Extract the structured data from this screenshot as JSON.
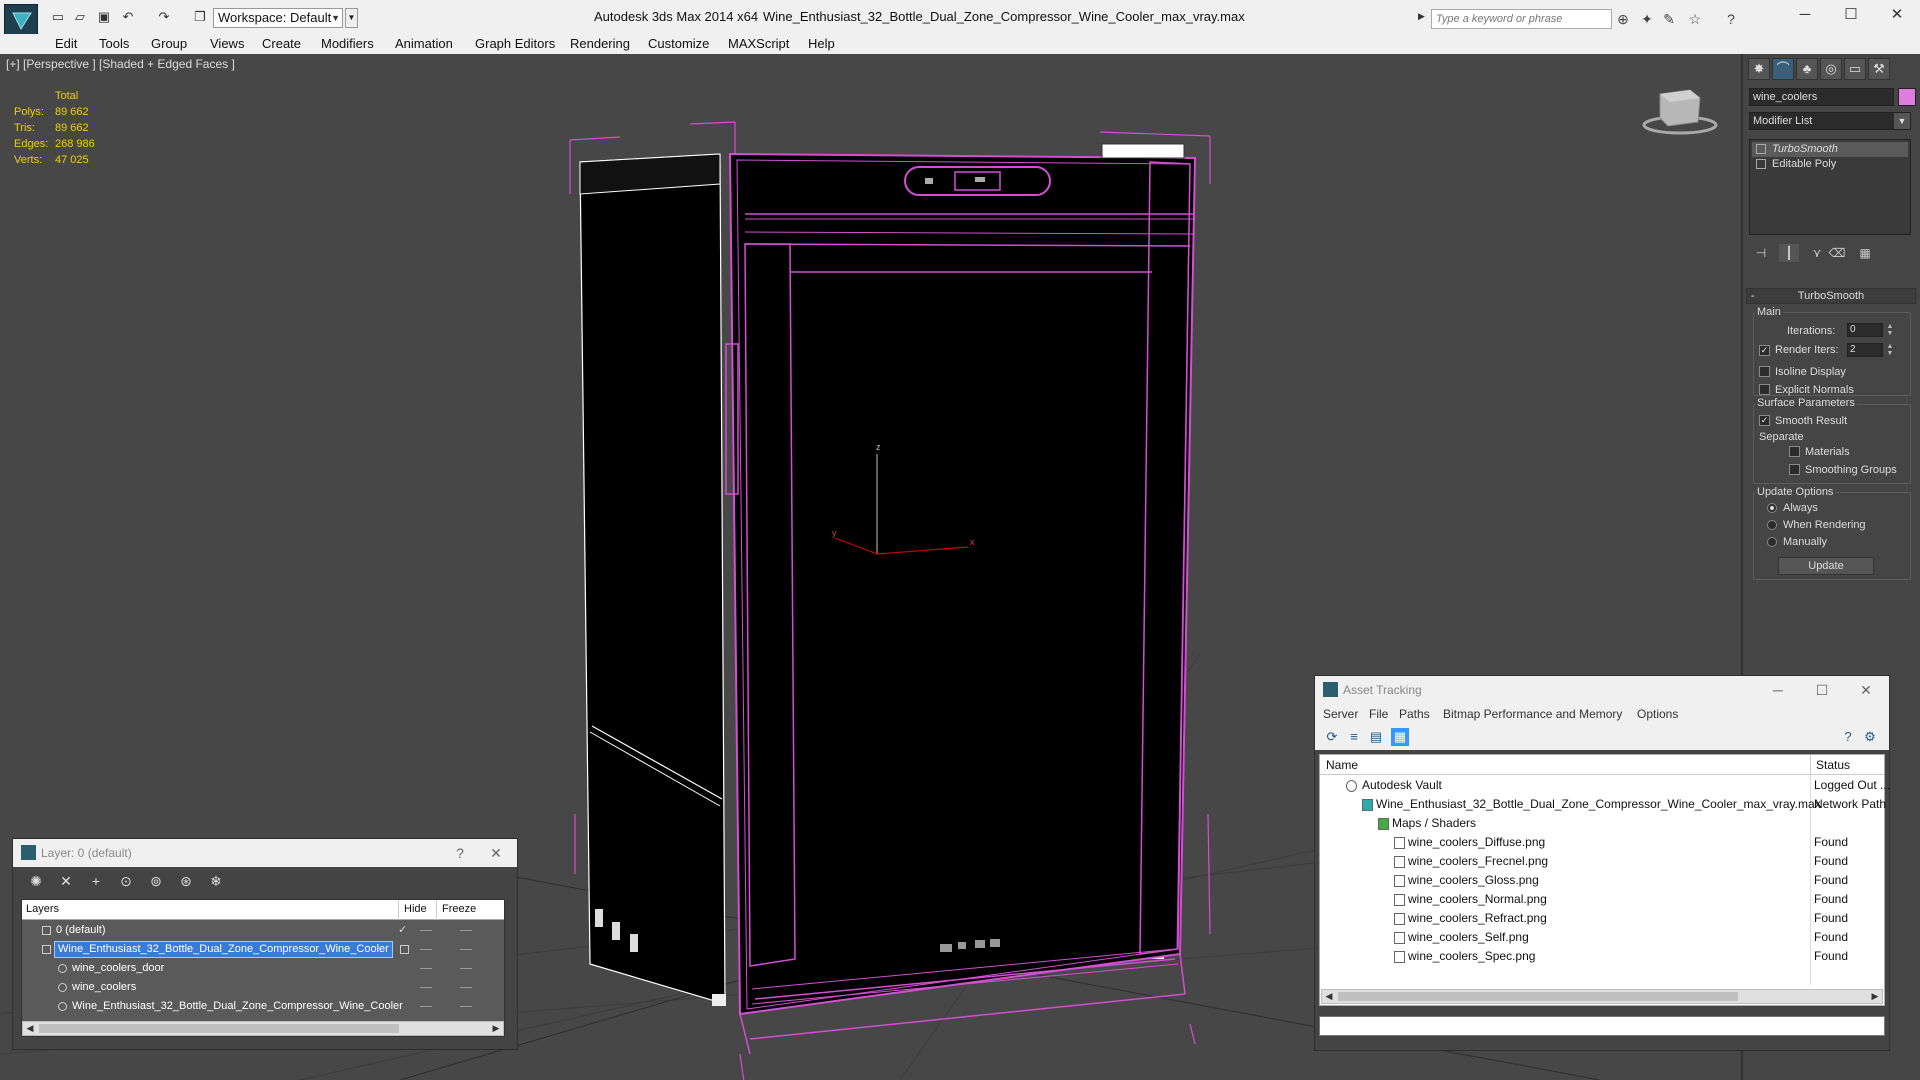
{
  "window": {
    "app_title": "Autodesk 3ds Max  2014 x64",
    "file_title": "Wine_Enthusiast_32_Bottle_Dual_Zone_Compressor_Wine_Cooler_max_vray.max",
    "workspace_label": "Workspace: Default",
    "search_placeholder": "Type a keyword or phrase",
    "minimize": "─",
    "maximize": "☐",
    "close": "✕"
  },
  "menu": [
    "Edit",
    "Tools",
    "Group",
    "Views",
    "Create",
    "Modifiers",
    "Animation",
    "Graph Editors",
    "Rendering",
    "Customize",
    "MAXScript",
    "Help"
  ],
  "viewport": {
    "label": "[+] [Perspective ] [Shaded + Edged Faces ]",
    "stats": {
      "header": "Total",
      "rows": [
        {
          "key": "Polys:",
          "value": "89 662"
        },
        {
          "key": "Tris:",
          "value": "89 662"
        },
        {
          "key": "Edges:",
          "value": "268 986"
        },
        {
          "key": "Verts:",
          "value": "47 025"
        }
      ]
    },
    "wire_color": "#d24fd2",
    "axis_x": "x",
    "axis_y": "y",
    "axis_z": "z"
  },
  "command_panel": {
    "object_name": "wine_coolers",
    "modifier_list": "Modifier List",
    "stack": [
      "TurboSmooth",
      "Editable Poly"
    ],
    "rollout_title": "TurboSmooth",
    "main_group": "Main",
    "iterations_label": "Iterations:",
    "iterations_value": "0",
    "render_iters_label": "Render Iters:",
    "render_iters_value": "2",
    "isoline_label": "Isoline Display",
    "explicit_normals_label": "Explicit Normals",
    "surface_group": "Surface Parameters",
    "smooth_result_label": "Smooth Result",
    "separate_label": "Separate",
    "materials_label": "Materials",
    "smoothing_groups_label": "Smoothing Groups",
    "update_group": "Update Options",
    "always_label": "Always",
    "when_rendering_label": "When Rendering",
    "manually_label": "Manually",
    "update_button": "Update"
  },
  "asset_tracking": {
    "title": "Asset Tracking",
    "menu": [
      "Server",
      "File",
      "Paths",
      "Bitmap Performance and Memory",
      "Options"
    ],
    "col_name": "Name",
    "col_status": "Status",
    "rows": [
      {
        "name": "Autodesk Vault",
        "status": "Logged Out ..."
      },
      {
        "name": "Wine_Enthusiast_32_Bottle_Dual_Zone_Compressor_Wine_Cooler_max_vray.max",
        "status": "Network Path"
      },
      {
        "name": "Maps / Shaders",
        "status": ""
      },
      {
        "name": "wine_coolers_Diffuse.png",
        "status": "Found"
      },
      {
        "name": "wine_coolers_Frecnel.png",
        "status": "Found"
      },
      {
        "name": "wine_coolers_Gloss.png",
        "status": "Found"
      },
      {
        "name": "wine_coolers_Normal.png",
        "status": "Found"
      },
      {
        "name": "wine_coolers_Refract.png",
        "status": "Found"
      },
      {
        "name": "wine_coolers_Self.png",
        "status": "Found"
      },
      {
        "name": "wine_coolers_Spec.png",
        "status": "Found"
      }
    ]
  },
  "layer_panel": {
    "title": "Layer: 0 (default)",
    "help": "?",
    "col_layers": "Layers",
    "col_hide": "Hide",
    "col_freeze": "Freeze",
    "rows": [
      {
        "name": "0 (default)"
      },
      {
        "name": "Wine_Enthusiast_32_Bottle_Dual_Zone_Compressor_Wine_Cooler"
      },
      {
        "name": "wine_coolers_door"
      },
      {
        "name": "wine_coolers"
      },
      {
        "name": "Wine_Enthusiast_32_Bottle_Dual_Zone_Compressor_Wine_Cooler"
      }
    ]
  }
}
